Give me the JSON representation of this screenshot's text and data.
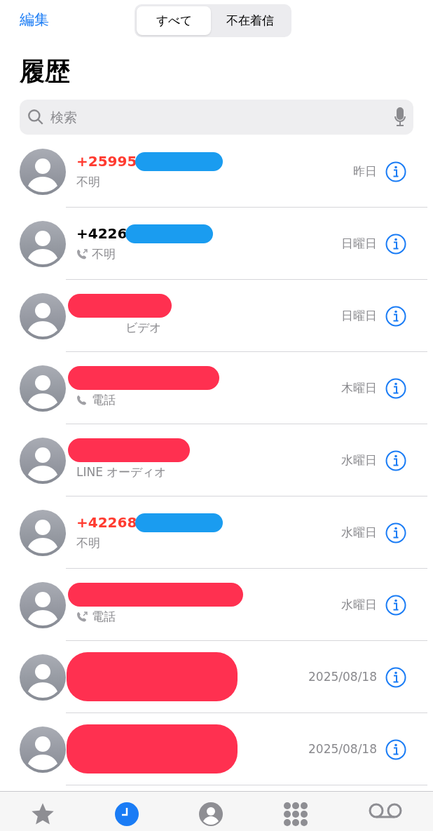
{
  "nav": {
    "edit": "編集",
    "segments": [
      {
        "label": "すべて",
        "selected": true
      },
      {
        "label": "不在着信",
        "selected": false
      }
    ]
  },
  "title": "履歴",
  "search": {
    "placeholder": "検索"
  },
  "rows": [
    {
      "name": "+25995",
      "missed": true,
      "subtitle": "不明",
      "date": "昨日",
      "redaction": {
        "kind": "trail",
        "color": "#1a9cf0"
      }
    },
    {
      "name": "+4226",
      "missed": false,
      "call_icon": {
        "kind": "outgoing"
      },
      "subtitle": "不明",
      "date": "日曜日",
      "redaction": {
        "kind": "trail",
        "color": "#1a9cf0"
      }
    },
    {
      "subtitle": "ビデオ",
      "indent": true,
      "date": "日曜日",
      "redaction": {
        "kind": "name",
        "color": "#ff3050"
      }
    },
    {
      "call_icon": {
        "kind": "phone"
      },
      "subtitle": "電話",
      "date": "木曜日",
      "redaction": {
        "kind": "name",
        "color": "#ff3050"
      }
    },
    {
      "subtitle": "LINE オーディオ",
      "date": "水曜日",
      "redaction": {
        "kind": "name",
        "color": "#ff3050"
      }
    },
    {
      "name": "+42268",
      "missed": true,
      "subtitle": "不明",
      "date": "水曜日",
      "redaction": {
        "kind": "trail",
        "color": "#1a9cf0"
      }
    },
    {
      "call_icon": {
        "kind": "outgoing"
      },
      "subtitle": "電話",
      "date": "水曜日",
      "redaction": {
        "kind": "name",
        "color": "#ff3050"
      }
    },
    {
      "date": "2025/08/18",
      "redaction": {
        "kind": "both",
        "color": "#ff3050"
      }
    },
    {
      "date": "2025/08/18",
      "redaction": {
        "kind": "both",
        "color": "#ff3050"
      }
    }
  ],
  "tabbar": [
    {
      "kind": "favorites",
      "selected": false
    },
    {
      "kind": "recents",
      "selected": true
    },
    {
      "kind": "contacts",
      "selected": false
    },
    {
      "kind": "keypad",
      "selected": false
    },
    {
      "kind": "voicemail",
      "selected": false
    }
  ]
}
